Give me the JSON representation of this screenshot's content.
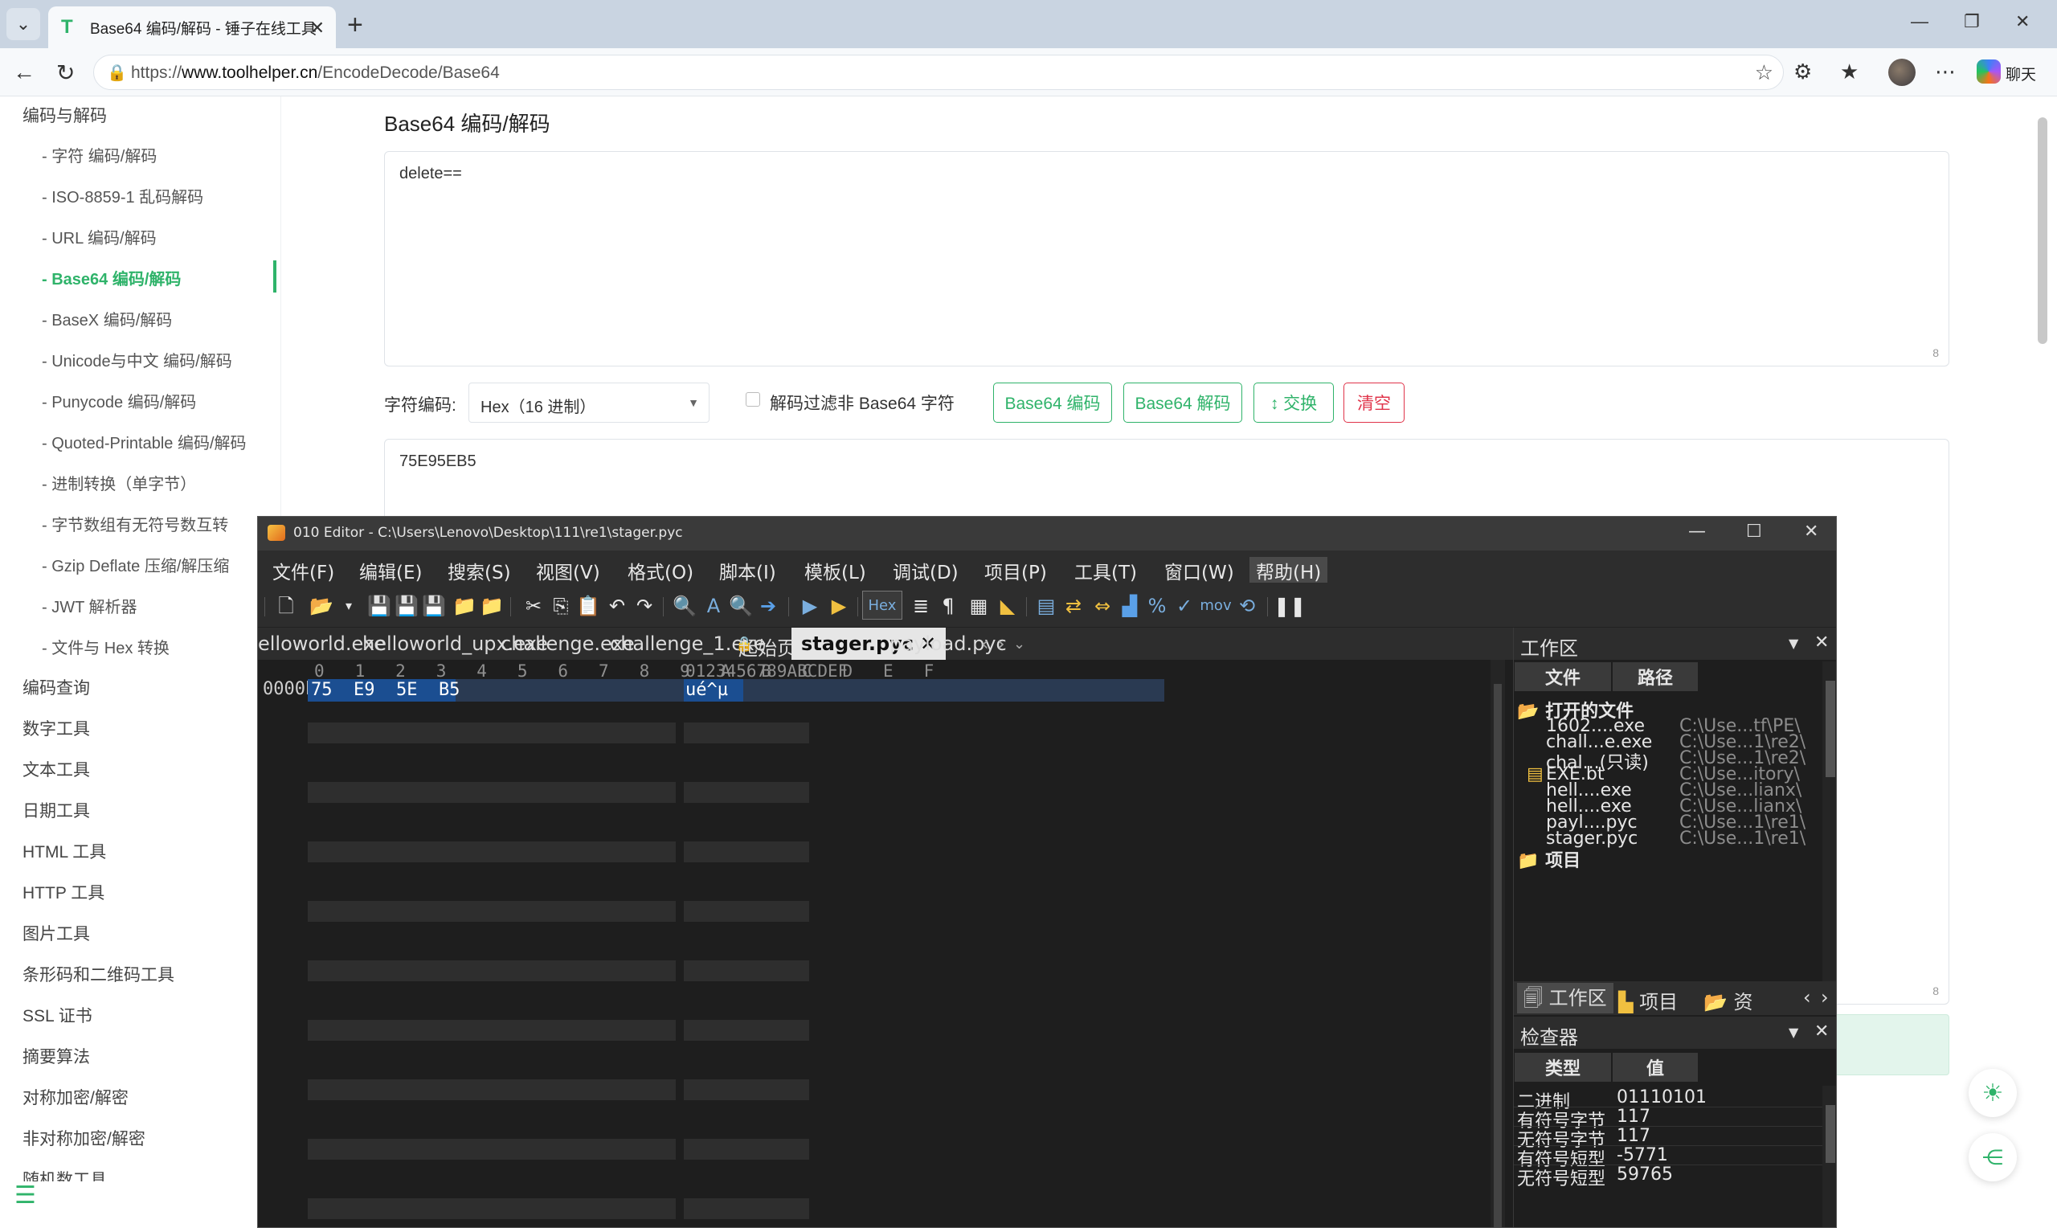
{
  "browser": {
    "tab_title": "Base64 编码/解码 - 锤子在线工具",
    "url_prefix": "https://",
    "url_host": "www.toolhelper.cn",
    "url_path": "/EncodeDecode/Base64",
    "chat_label": "聊天"
  },
  "sidebar": {
    "category_top": "编码与解码",
    "items": [
      "- 字符  编码/解码",
      "- ISO-8859-1 乱码解码",
      "- URL  编码/解码",
      "- Base64  编码/解码",
      "- BaseX  编码/解码",
      "- Unicode与中文  编码/解码",
      "- Punycode  编码/解码",
      "- Quoted-Printable  编码/解码",
      "- 进制转换（单字节）",
      "- 字节数组有无符号数互转",
      "- Gzip Deflate 压缩/解压缩",
      "- JWT 解析器",
      "- 文件与 Hex 转换"
    ],
    "categories": [
      "编码查询",
      "数字工具",
      "文本工具",
      "日期工具",
      "HTML 工具",
      "HTTP 工具",
      "图片工具",
      "条形码和二维码工具",
      "SSL 证书",
      "摘要算法",
      "对称加密/解密",
      "非对称加密/解密",
      "随机数工具"
    ]
  },
  "main": {
    "title": "Base64 编码/解码",
    "input_text": "delete==",
    "input_count": "8",
    "encoding_label": "字符编码:",
    "encoding_value": "Hex（16 进制）",
    "filter_label": "解码过滤非 Base64 字符",
    "buttons": {
      "encode": "Base64 编码",
      "decode": "Base64 解码",
      "swap": "↕ 交换",
      "clear": "清空"
    },
    "output_text": "75E95EB5",
    "output_count": "8"
  },
  "editor": {
    "window_title": "010 Editor - C:\\Users\\Lenovo\\Desktop\\111\\re1\\stager.pyc",
    "menu": [
      "文件(F)",
      "编辑(E)",
      "搜索(S)",
      "视图(V)",
      "格式(O)",
      "脚本(I)",
      "模板(L)",
      "调试(D)",
      "项目(P)",
      "工具(T)",
      "窗口(W)",
      "帮助(H)"
    ],
    "toolbar_hex": "Hex",
    "toolbar_mov": "mov",
    "tabs": [
      "elloworld.exe",
      "helloworld_upx.exe",
      "challenge.exe",
      "challenge_1.exe",
      "起始页",
      "stager.pyc",
      "payload.pyc"
    ],
    "active_tab_close": "✕",
    "hex_header": "0   1   2   3   4   5   6   7   8   9   A   B   C   D   E   F",
    "ascii_header": "0123456789ABCDEF",
    "address": "0000h",
    "bytes": "75  E9  5E  B5",
    "ascii": "ué^µ",
    "workspace": {
      "title": "工作区",
      "col_file": "文件",
      "col_path": "路径",
      "group_open": "打开的文件",
      "files": [
        {
          "name": "1602....exe",
          "path": "C:\\Use...tf\\PE\\"
        },
        {
          "name": "chall...e.exe",
          "path": "C:\\Use...1\\re2\\"
        },
        {
          "name": "chal...(只读)",
          "path": "C:\\Use...1\\re2\\"
        },
        {
          "name": "EXE.bt",
          "path": "C:\\Use...itory\\"
        },
        {
          "name": "hell....exe",
          "path": "C:\\Use...lianx\\"
        },
        {
          "name": "hell....exe",
          "path": "C:\\Use...lianx\\"
        },
        {
          "name": "payl....pyc",
          "path": "C:\\Use...1\\re1\\"
        },
        {
          "name": "stager.pyc",
          "path": "C:\\Use...1\\re1\\"
        }
      ],
      "group_project": "项目",
      "bottom_tabs": [
        "工作区",
        "项目",
        "资"
      ]
    },
    "inspector": {
      "title": "检查器",
      "col_type": "类型",
      "col_value": "值",
      "rows": [
        {
          "type": "二进制",
          "value": "01110101"
        },
        {
          "type": "有符号字节",
          "value": "117"
        },
        {
          "type": "无符号字节",
          "value": "117"
        },
        {
          "type": "有符号短型",
          "value": "-5771"
        },
        {
          "type": "无符号短型",
          "value": "59765"
        }
      ]
    }
  }
}
